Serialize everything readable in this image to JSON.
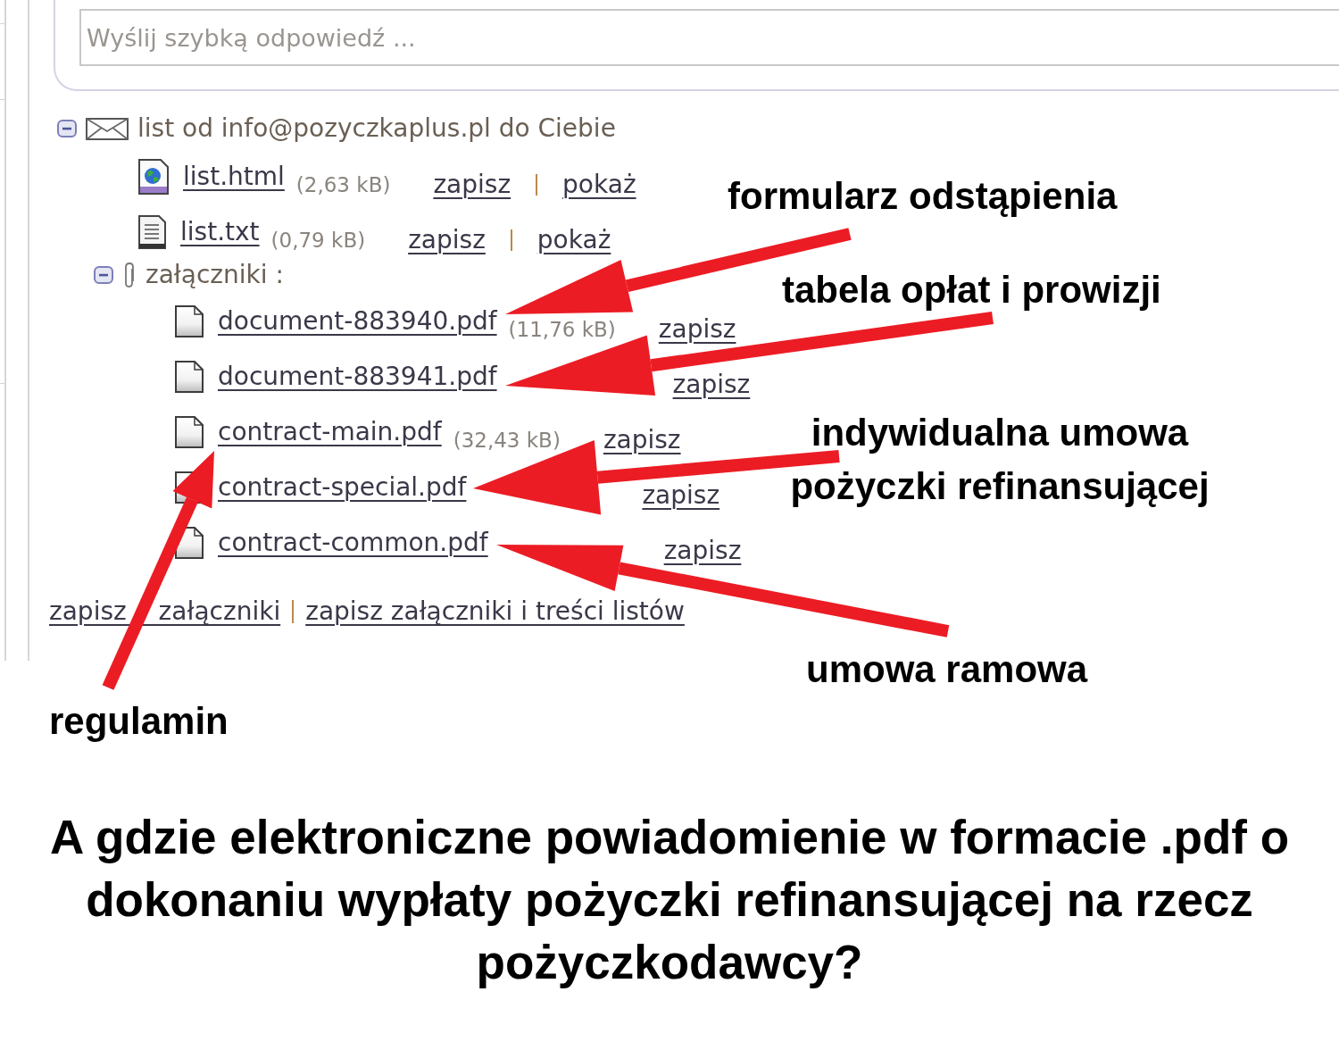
{
  "reply": {
    "placeholder": "Wyślij szybką odpowiedź ..."
  },
  "tree": [
    {
      "kind": "message",
      "label": "list od info@pozyczkaplus.pl do Ciebie",
      "expanded": true,
      "children": [
        {
          "kind": "html_file",
          "name": "list.html",
          "size": "(2,63 kB)",
          "actions": [
            "zapisz",
            "pokaż"
          ]
        },
        {
          "kind": "text_file",
          "name": "list.txt",
          "size": "(0,79 kB)",
          "actions": [
            "zapisz",
            "pokaż"
          ]
        },
        {
          "kind": "folder",
          "label": "załączniki :",
          "expanded": true,
          "children": [
            {
              "kind": "pdf_file",
              "name": "document-883940.pdf",
              "size": "(11,76 kB)",
              "actions": [
                "zapisz"
              ]
            },
            {
              "kind": "pdf_file",
              "name": "document-883941.pdf",
              "actions": [
                "zapisz"
              ]
            },
            {
              "kind": "pdf_file",
              "name": "contract-main.pdf",
              "size": "(32,43 kB)",
              "actions": [
                "zapisz"
              ]
            },
            {
              "kind": "pdf_file",
              "name": "contract-special.pdf",
              "actions": [
                "zapisz"
              ]
            },
            {
              "kind": "pdf_file",
              "name": "contract-common.pdf",
              "actions": [
                "zapisz"
              ]
            }
          ]
        }
      ]
    }
  ],
  "footer_links": [
    "zapisz załączniki",
    "zapisz załączniki i treści listów"
  ],
  "annotations": [
    {
      "label": "formularz odstąpienia"
    },
    {
      "label": "tabela opłat i prowizji"
    },
    {
      "label": "indywidualna umowa pożyczki refinansującej"
    },
    {
      "label": "umowa ramowa"
    },
    {
      "label": "regulamin"
    }
  ],
  "question": "A gdzie elektroniczne powiadomienie w formacie .pdf o dokonaniu wypłaty pożyczki refinansującej na rzecz pożyczkodawcy?"
}
